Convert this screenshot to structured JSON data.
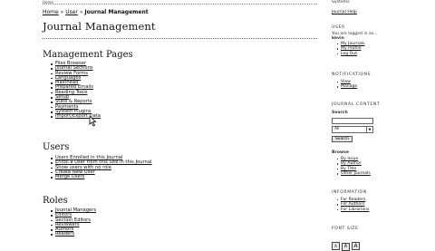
{
  "header": {
    "top_fragment": "Home",
    "breadcrumb": {
      "home": "Home",
      "sep1": " » ",
      "user": "User",
      "sep2": " » ",
      "current": "Journal Management"
    },
    "page_title": "Journal Management"
  },
  "sections": {
    "management": {
      "title": "Management Pages",
      "items": [
        "Files Browser",
        "Journal Sections",
        "Review Forms",
        "Languages",
        "Masthead",
        "Prepared Emails",
        "Reading Tools",
        "Setup",
        "Stats & Reports",
        "Payments",
        "System Plugins",
        "Import/Export Data"
      ]
    },
    "users": {
      "title": "Users",
      "items": [
        "Users Enrolled in this Journal",
        "Enroll a User from this Site in this Journal",
        "Show users with no role",
        "Create New User",
        "Merge Users"
      ]
    },
    "roles": {
      "title": "Roles",
      "items": [
        "Journal Managers",
        "Editors",
        "Section Editors",
        "Reviewers",
        "Authors",
        "Readers"
      ]
    }
  },
  "sidebar": {
    "top_fragment": "Systems",
    "journal_help": "Journal Help",
    "user": {
      "heading": "USER",
      "logged_in_text": "You are logged in as...",
      "username": "kevin",
      "links": [
        "My Journals",
        "My Profile",
        "Log Out"
      ]
    },
    "notifications": {
      "heading": "NOTIFICATIONS",
      "links": [
        "View",
        "Manage"
      ]
    },
    "journal_content": {
      "heading": "JOURNAL CONTENT",
      "search_label": "Search",
      "search_value": "",
      "scope_value": "All",
      "search_button": "Search",
      "browse_label": "Browse",
      "browse_links": [
        "By Issue",
        "By Author",
        "By Title",
        "Other Journals"
      ]
    },
    "information": {
      "heading": "INFORMATION",
      "links": [
        "For Readers",
        "For Authors",
        "For Librarians"
      ]
    },
    "font_size": {
      "heading": "FONT SIZE",
      "buttons": [
        "A",
        "A",
        "A"
      ]
    }
  }
}
